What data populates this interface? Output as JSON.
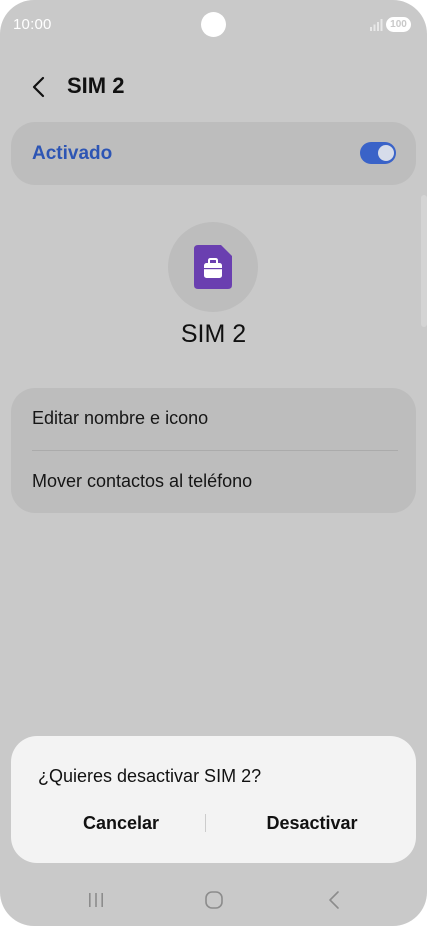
{
  "status_bar": {
    "time": "10:00",
    "battery": "100",
    "icons": [
      "camera-cutout-icon",
      "signal-icon",
      "battery-icon"
    ]
  },
  "header": {
    "title": "SIM 2",
    "back_icon": "chevron-left-icon"
  },
  "master_switch": {
    "label": "Activado",
    "state": "on",
    "accent_color": "#3a63c8"
  },
  "sim_card": {
    "icon": "sim-card-icon",
    "icon_color": "#6a3fb0",
    "name": "SIM 2"
  },
  "options": [
    {
      "label": "Editar nombre e icono"
    },
    {
      "label": "Mover contactos al teléfono"
    }
  ],
  "dialog": {
    "title": "¿Quieres desactivar SIM 2?",
    "cancel_label": "Cancelar",
    "confirm_label": "Desactivar"
  },
  "nav_bar": {
    "icons": [
      "recents-icon",
      "home-icon",
      "back-icon"
    ]
  }
}
